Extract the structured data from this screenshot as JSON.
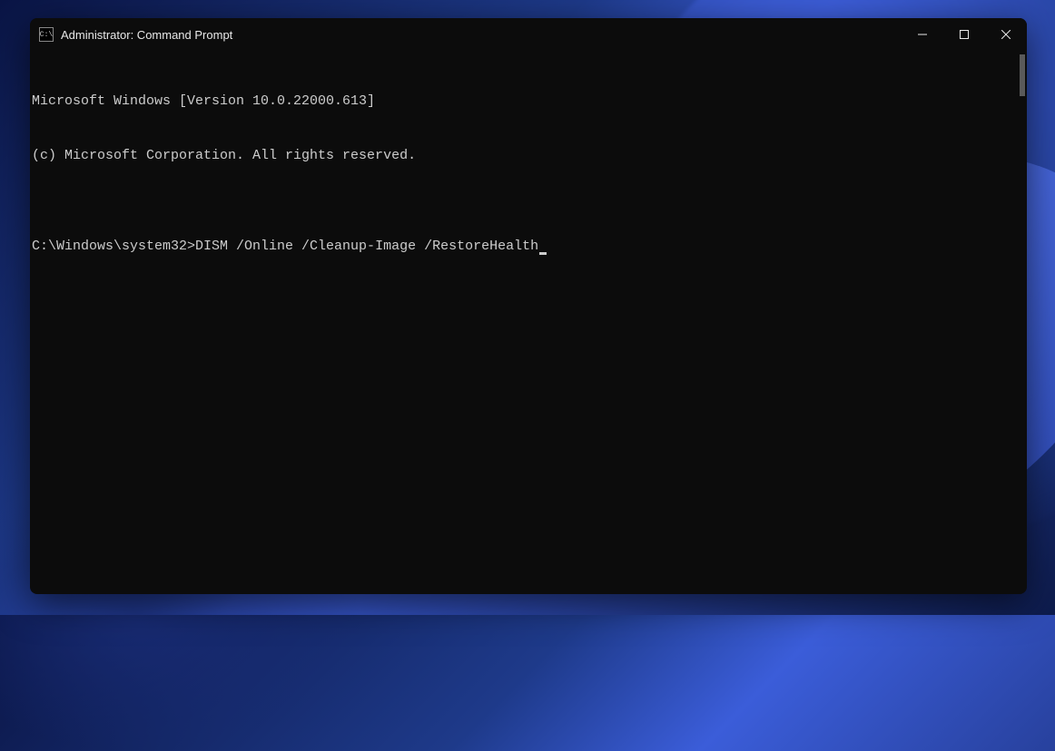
{
  "window": {
    "title": "Administrator: Command Prompt",
    "icon_label": "C:\\"
  },
  "terminal": {
    "line1": "Microsoft Windows [Version 10.0.22000.613]",
    "line2": "(c) Microsoft Corporation. All rights reserved.",
    "blank": "",
    "prompt": "C:\\Windows\\system32>",
    "command": "DISM /Online /Cleanup-Image /RestoreHealth"
  }
}
